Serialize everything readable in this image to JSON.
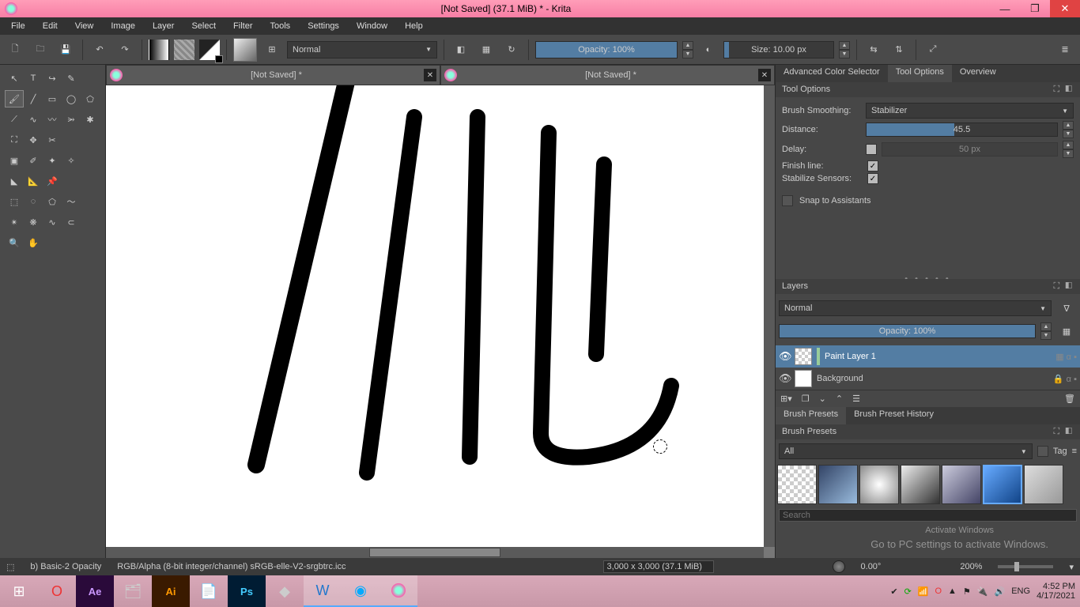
{
  "titlebar": {
    "title": "[Not Saved]  (37.1 MiB)  * - Krita"
  },
  "menu": [
    "File",
    "Edit",
    "View",
    "Image",
    "Layer",
    "Select",
    "Filter",
    "Tools",
    "Settings",
    "Window",
    "Help"
  ],
  "toolbar": {
    "blend_mode": "Normal",
    "opacity_label": "Opacity: 100%",
    "size_label": "Size: 10.00 px"
  },
  "tabs": [
    {
      "label": "[Not Saved]  *"
    },
    {
      "label": "[Not Saved]  *"
    }
  ],
  "right_tabs": {
    "a": "Advanced Color Selector",
    "b": "Tool Options",
    "c": "Overview"
  },
  "tool_options": {
    "header": "Tool Options",
    "smoothing_label": "Brush Smoothing:",
    "smoothing_value": "Stabilizer",
    "distance_label": "Distance:",
    "distance_value": "45.5",
    "delay_label": "Delay:",
    "delay_value": "50 px",
    "finish_line": "Finish line:",
    "stabilize_sensors": "Stabilize Sensors:",
    "snap": "Snap to Assistants"
  },
  "layers": {
    "header": "Layers",
    "blend": "Normal",
    "opacity": "Opacity:  100%",
    "layer1": "Paint Layer 1",
    "layer2": "Background"
  },
  "brush_presets": {
    "tab1": "Brush Presets",
    "tab2": "Brush Preset History",
    "header": "Brush Presets",
    "filter": "All",
    "tag": "Tag",
    "search": "Search"
  },
  "status": {
    "brush": "b) Basic-2 Opacity",
    "profile": "RGB/Alpha (8-bit integer/channel)  sRGB-elle-V2-srgbtrc.icc",
    "dims": "3,000 x 3,000 (37.1 MiB)",
    "angle": "0.00°",
    "zoom": "200%"
  },
  "watermark": {
    "line1": "Activate Windows",
    "line2": "Go to PC settings to activate Windows."
  },
  "tray": {
    "lang": "ENG",
    "time": "4:52 PM",
    "date": "4/17/2021"
  }
}
